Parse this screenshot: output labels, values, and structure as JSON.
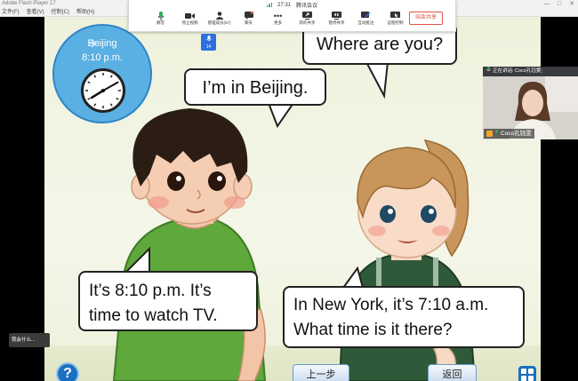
{
  "window": {
    "title": "Adobe Flash Player 17",
    "controls": [
      "—",
      "□",
      "✕"
    ],
    "menu": [
      "文件(F)",
      "查看(V)",
      "控制(C)",
      "帮助(H)"
    ]
  },
  "meeting": {
    "time": "27:31",
    "app_name": "腾讯会议",
    "buttons": [
      {
        "label": "静音",
        "icon": "microphone-icon"
      },
      {
        "label": "停止视频",
        "icon": "video-camera-icon"
      },
      {
        "label": "管理成员(57)",
        "icon": "members-icon"
      },
      {
        "label": "聊天",
        "icon": "chat-icon"
      },
      {
        "label": "更多",
        "icon": "more-icon"
      },
      {
        "label": "新的共享",
        "icon": "new-share-icon"
      },
      {
        "label": "暂停共享",
        "icon": "pause-share-icon"
      },
      {
        "label": "互动批注",
        "icon": "annotate-icon"
      },
      {
        "label": "远程控制",
        "icon": "remote-control-icon"
      }
    ],
    "end_share": "结束共享",
    "mic_badge_count": "14",
    "speaker_header": "正在讲话: Coco孔钰雯;",
    "participant_name": "Coco孔钰雯",
    "chat_popup": "我会什么..."
  },
  "lesson": {
    "clock_city": "Beijing",
    "clock_time": "8:10 p.m.",
    "boy_bubble_top": "I’m in Beijing.",
    "girl_bubble_top": "Where are you?",
    "boy_bubble_bottom": [
      "It’s 8:10 p.m. It’s",
      "time to watch TV."
    ],
    "girl_bubble_bottom": [
      "In New York, it’s 7:10 a.m.",
      "What time is it there?"
    ],
    "help_label": "?",
    "prev_label": "上一步",
    "back_label": "返回"
  },
  "colors": {
    "clock_blue": "#5ab0e3",
    "toolbar_accent": "#2d6fde",
    "end_share_red": "#e3554a",
    "boy_shirt": "#5fa83b",
    "girl_dress": "#2f5a39"
  }
}
